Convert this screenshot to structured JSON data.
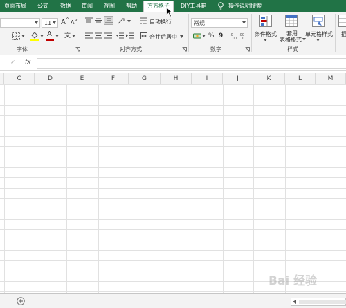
{
  "tabs": [
    {
      "label": "页面布局",
      "active": false
    },
    {
      "label": "公式",
      "active": false
    },
    {
      "label": "数据",
      "active": false
    },
    {
      "label": "审阅",
      "active": false
    },
    {
      "label": "视图",
      "active": false
    },
    {
      "label": "帮助",
      "active": false
    },
    {
      "label": "方方格子",
      "active": true
    },
    {
      "label": "DIY工具箱",
      "active": false
    },
    {
      "label": "操作说明搜索",
      "active": false
    }
  ],
  "ribbon": {
    "font": {
      "size_value": "11",
      "grow_label": "A",
      "shrink_label": "A",
      "wen_label": "文",
      "fontcolor_label": "A",
      "group_label": "字体"
    },
    "align": {
      "wrap_label": "自动换行",
      "merge_label": "合并后居中",
      "group_label": "对齐方式"
    },
    "number": {
      "format_value": "常规",
      "percent_label": "%",
      "comma_label": "9",
      "group_label": "数字"
    },
    "styles": {
      "conditional_label": "条件格式",
      "table_label_1": "套用",
      "table_label_2": "表格格式",
      "cell_label": "单元格样式",
      "group_label": "样式"
    },
    "insert_partial": "插"
  },
  "formula_bar": {
    "check_label": "✓",
    "fx_label": "fx",
    "value": ""
  },
  "columns": [
    "C",
    "D",
    "E",
    "F",
    "G",
    "H",
    "I",
    "J",
    "K",
    "L",
    "M"
  ],
  "sheet_bar": {
    "add_label": "+"
  },
  "watermark": "Bai 经验",
  "colors": {
    "accent": "#217346",
    "ribbon_bg": "#f3f3f3",
    "gridline": "#e1e1e1",
    "font_color_red": "#c00000",
    "highlight_yellow": "#ffff00"
  }
}
